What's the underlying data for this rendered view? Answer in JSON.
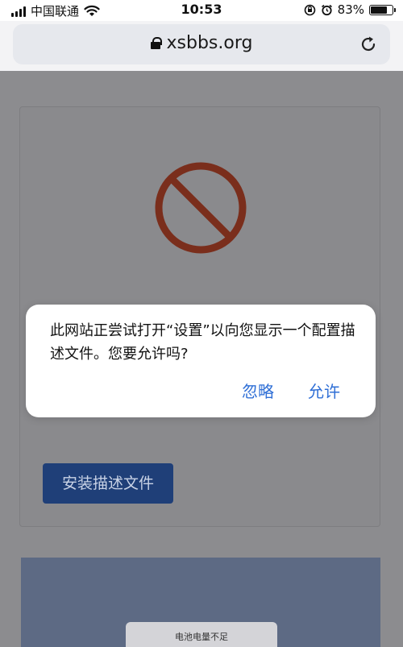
{
  "status_bar": {
    "carrier": "中国联通",
    "time": "10:53",
    "battery_percent": "83%",
    "battery_level": 0.83
  },
  "browser": {
    "domain": "xsbbs.org",
    "lock_icon": "lock-icon",
    "reload_icon": "reload-icon"
  },
  "page": {
    "blocked_icon": "prohibited-icon",
    "install_button_label": "安装描述文件",
    "battery_toast": "电池电量不足"
  },
  "dialog": {
    "message": "此网站正尝试打开“设置”以向您显示一个配置描述文件。您要允许吗?",
    "ignore_label": "忽略",
    "allow_label": "允许"
  },
  "colors": {
    "accent_link": "#2f6fd6",
    "install_button": "#1f3f78",
    "ban_icon": "#7a2e1c"
  }
}
